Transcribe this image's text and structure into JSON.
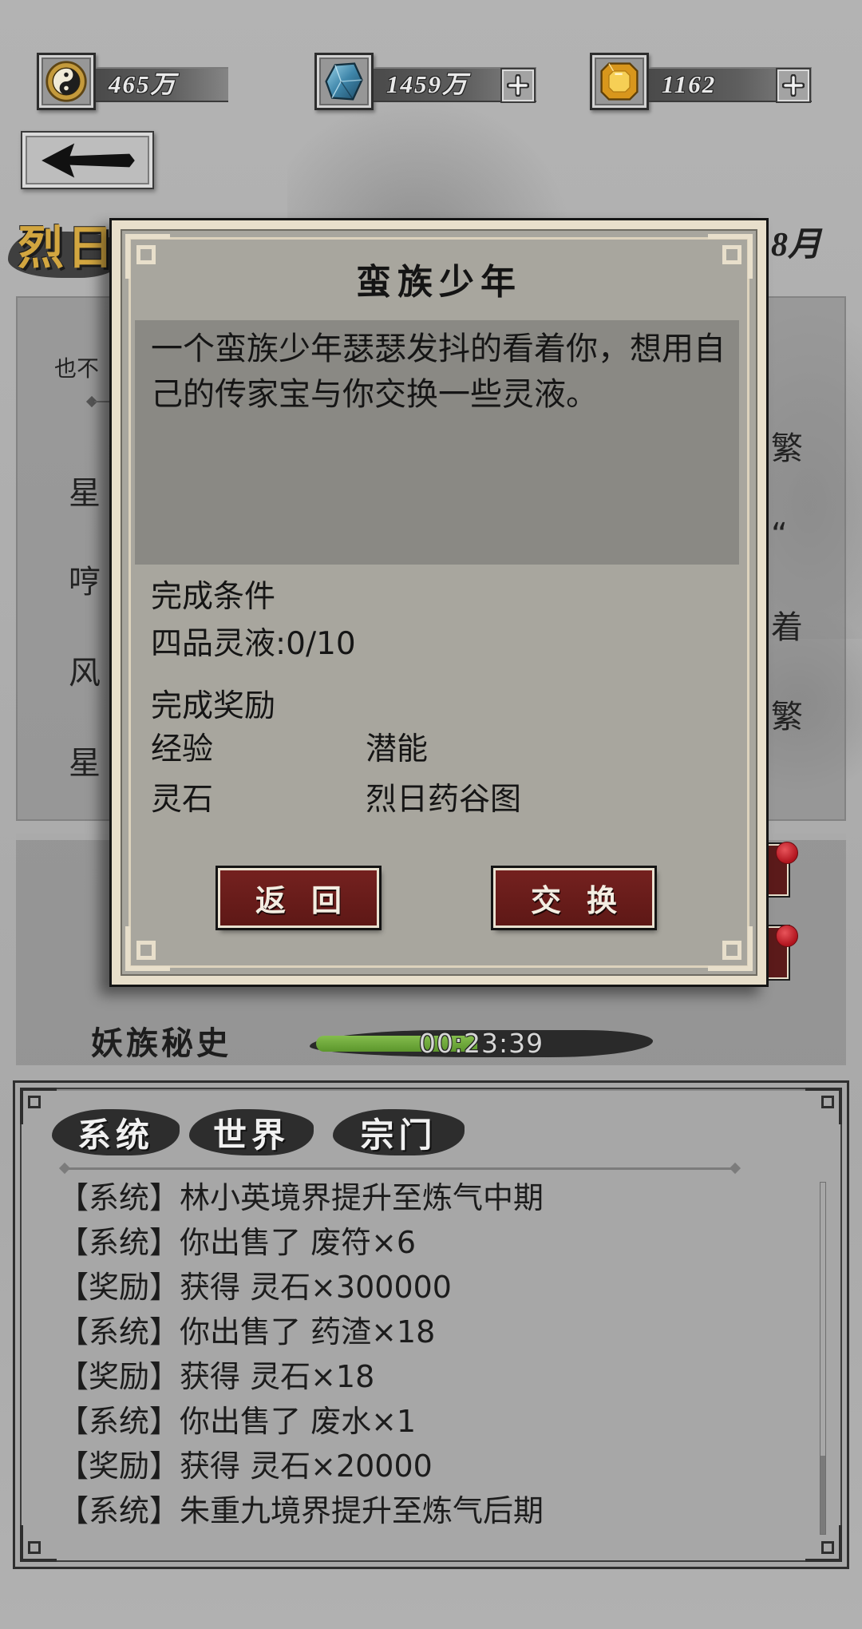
{
  "resources": [
    {
      "icon": "yin-yang-coin-icon",
      "value": "465万"
    },
    {
      "icon": "blue-crystal-icon",
      "value": "1459万",
      "add_icon": "plus-icon"
    },
    {
      "icon": "gold-gem-icon",
      "value": "1162",
      "add_icon": "plus-icon"
    }
  ],
  "navigation": {
    "back_icon": "left-arrow-icon"
  },
  "header": {
    "title": "烈日",
    "date_fragment": "8月"
  },
  "event_list": {
    "left_fragments": [
      "也不",
      "星",
      "哼",
      "风",
      "星"
    ],
    "right_fragments": [
      "繁",
      "“",
      "着",
      "繁"
    ]
  },
  "secret_history": {
    "label": "妖族秘史",
    "timer": "00:23:39",
    "progress": 0.49
  },
  "dialog": {
    "title": "蛮族少年",
    "description": "一个蛮族少年瑟瑟发抖的看着你，想用自己的传家宝与你交换一些灵液。",
    "condition_heading": "完成条件",
    "condition": "四品灵液:0/10",
    "reward_heading": "完成奖励",
    "rewards": [
      "经验",
      "潜能",
      "灵石",
      "烈日药谷图"
    ],
    "back_label": "返回",
    "exchange_label": "交换"
  },
  "chat": {
    "tabs": [
      "系统",
      "世界",
      "宗门"
    ],
    "messages": [
      "【系统】林小英境界提升至炼气中期",
      "【系统】你出售了 废符×6",
      "【奖励】获得 灵石×300000",
      "【系统】你出售了 药渣×18",
      "【奖励】获得 灵石×18",
      "【系统】你出售了 废水×1",
      "【奖励】获得 灵石×20000",
      "【系统】朱重九境界提升至炼气后期"
    ]
  },
  "colors": {
    "title_gold": "#d2a640",
    "button_red": "#6b1d1d",
    "progress_green": "#6fa63c",
    "notification_red": "#c0202a",
    "dialog_cream": "#e8dfcb"
  }
}
